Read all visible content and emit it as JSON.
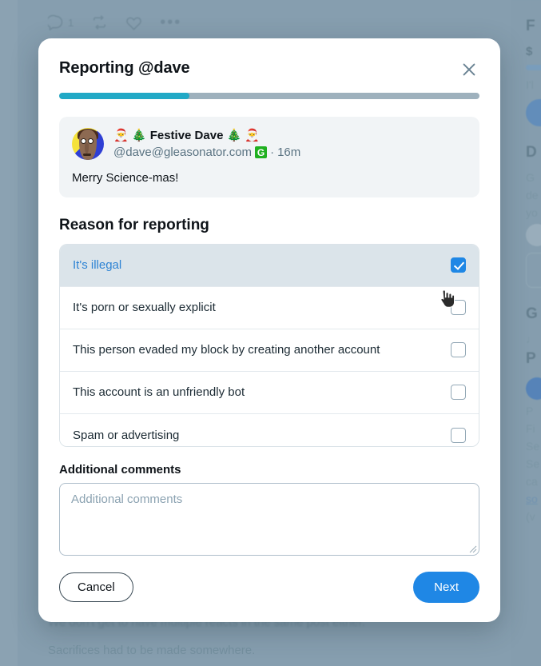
{
  "background": {
    "action_bar": {
      "reply_icon": "reply-icon",
      "reply_count": "1",
      "boost_icon": "boost-icon",
      "favourite_icon": "heart-icon",
      "more_icon": "ellipsis-icon"
    },
    "post_lines": [
      "We don't get to have multiple reacts in the same post either.",
      "Sacrifices had to be made somewhere."
    ],
    "sidebar": {
      "heading_1": "F",
      "sub_1": "$",
      "line_1": "I'l",
      "heading_2": "D",
      "lines_2": [
        "G",
        "de",
        "yo"
      ],
      "heading_3": "G",
      "note_3": "♩",
      "heading_4": "P",
      "lines_4": [
        "P",
        "Fi",
        "Se"
      ],
      "lines_5": [
        "Se",
        "ca",
        "so",
        "(v"
      ]
    }
  },
  "modal": {
    "title": "Reporting @dave",
    "close_label": "×",
    "progress": {
      "percent": 31,
      "fill_color": "#21a9c6",
      "track_color": "#9eb1bd"
    },
    "status": {
      "avatar_alt": "dave avatar",
      "display_name": "🎅 🎄 Festive Dave 🎄 🎅",
      "handle": "@dave@gleasonator.com",
      "instance_badge": "G",
      "separator": "·",
      "timestamp": "16m",
      "content": "Merry Science-mas!"
    },
    "reason": {
      "heading": "Reason for reporting",
      "options": [
        {
          "label": "It's illegal",
          "checked": true
        },
        {
          "label": "It's porn or sexually explicit",
          "checked": false
        },
        {
          "label": "This person evaded my block by creating another account",
          "checked": false
        },
        {
          "label": "This account is an unfriendly bot",
          "checked": false
        },
        {
          "label": "Spam or advertising",
          "checked": false
        }
      ]
    },
    "comments": {
      "label": "Additional comments",
      "value": "",
      "placeholder": "Additional comments"
    },
    "footer": {
      "cancel_label": "Cancel",
      "next_label": "Next"
    },
    "accent_color": "#1f87e5",
    "selected_row_bg": "#dbe4ea",
    "selected_row_text": "#2d83d4"
  }
}
